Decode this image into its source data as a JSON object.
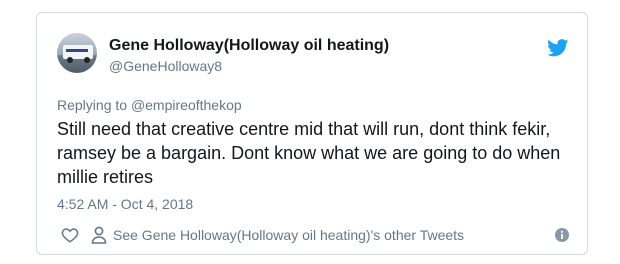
{
  "tweet": {
    "display_name": "Gene Holloway(Holloway oil heating)",
    "handle": "@GeneHolloway8",
    "replying_prefix": "Replying to ",
    "replying_to": "@empireofthekop",
    "text": "Still need that creative centre mid that will run, dont think fekir, ramsey be a bargain. Dont know what we are going to do when millie retires",
    "timestamp": "4:52 AM - Oct 4, 2018",
    "other_tweets_label": "See Gene Holloway(Holloway oil heating)'s other Tweets"
  },
  "icons": {
    "brand": "twitter-bird-icon",
    "like": "heart-icon",
    "profile": "person-icon",
    "info": "info-icon"
  },
  "colors": {
    "twitter_blue": "#1da1f2",
    "text": "#14171a",
    "muted": "#657786",
    "border": "#d6dbe0"
  }
}
